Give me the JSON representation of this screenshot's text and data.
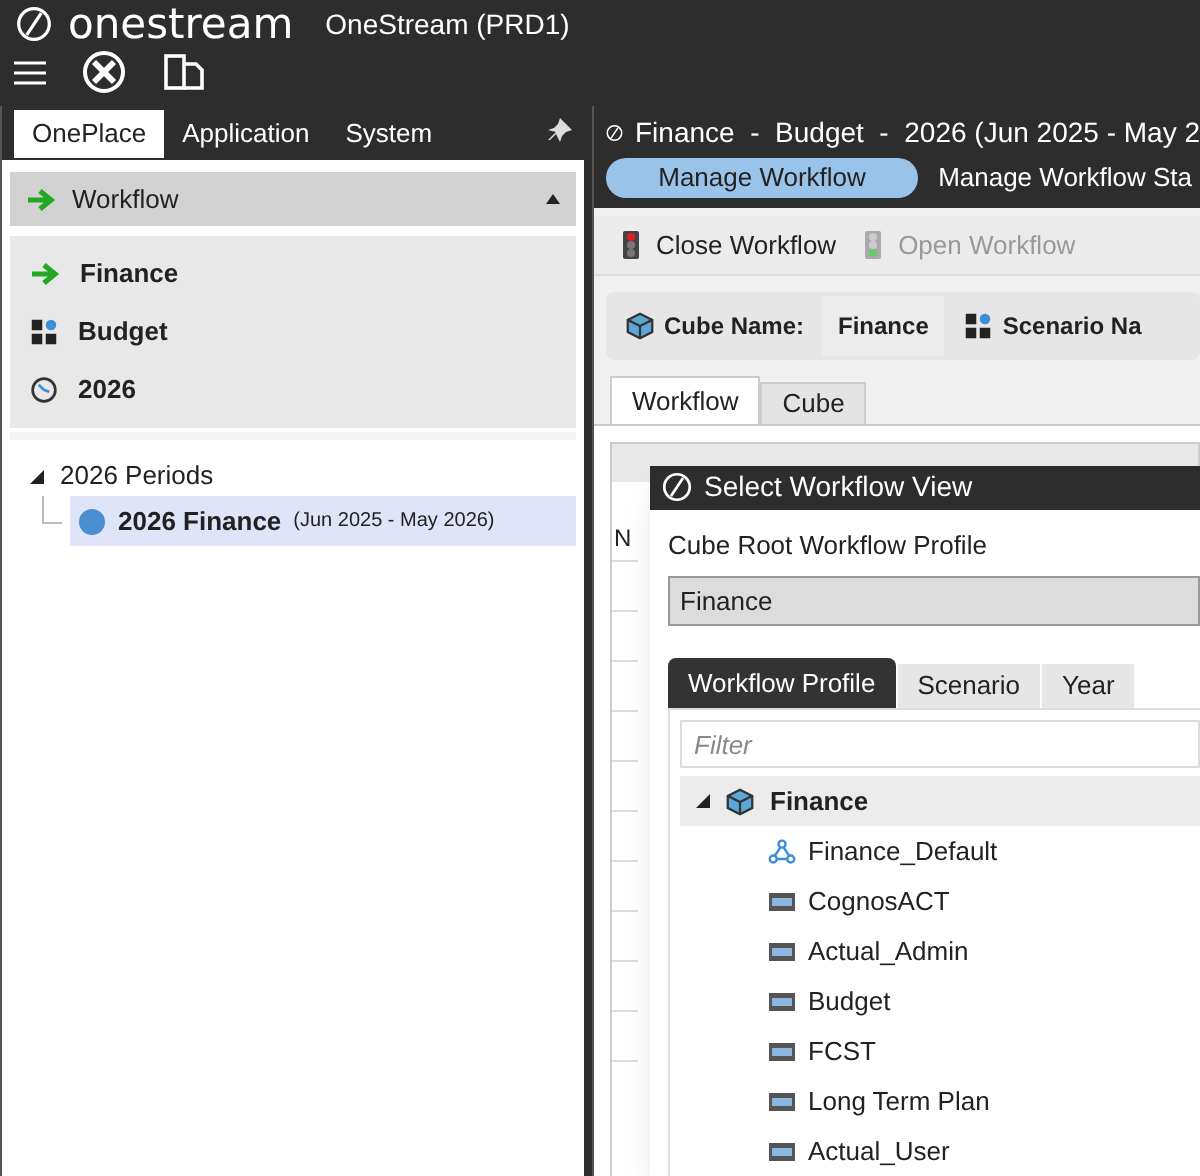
{
  "app": {
    "logo": "onestream",
    "title": "OneStream (PRD1)"
  },
  "left_panel": {
    "tabs": [
      {
        "label": "OnePlace",
        "selected": true
      },
      {
        "label": "Application",
        "selected": false
      },
      {
        "label": "System",
        "selected": false
      }
    ],
    "section": {
      "title": "Workflow",
      "expanded": true
    },
    "pov": [
      {
        "kind": "workflow",
        "label": "Finance"
      },
      {
        "kind": "scenario",
        "label": "Budget"
      },
      {
        "kind": "time",
        "label": "2026"
      }
    ],
    "tree": [
      {
        "label": "2026 Periods",
        "expanded": true,
        "children": [
          {
            "label": "2026 Finance",
            "detail": "(Jun 2025 - May 2026)",
            "selected": true
          }
        ]
      }
    ]
  },
  "right_panel": {
    "title": "Finance  -  Budget  -  2026 (Jun 2025 - May 2",
    "tabs": [
      {
        "label": "Manage Workflow",
        "selected": true
      },
      {
        "label": "Manage Workflow Sta",
        "selected": false
      }
    ],
    "toolbar": [
      {
        "label": "Close Workflow",
        "disabled": false
      },
      {
        "label": "Open Workflow",
        "disabled": true
      }
    ],
    "info": [
      {
        "kind": "cube",
        "label": "Cube Name:",
        "value": "Finance"
      },
      {
        "kind": "scenario",
        "label": "Scenario Na"
      }
    ],
    "tabs2": [
      {
        "label": "Workflow",
        "selected": true
      },
      {
        "label": "Cube",
        "selected": false
      }
    ],
    "grid": {
      "column_1": "N"
    }
  },
  "dialog": {
    "title": "Select Workflow View",
    "field_label": "Cube Root Workflow Profile",
    "field_value": "Finance",
    "tabs": [
      {
        "label": "Workflow Profile",
        "selected": true
      },
      {
        "label": "Scenario",
        "selected": false
      },
      {
        "label": "Year",
        "selected": false
      }
    ],
    "filter": {
      "placeholder": "Filter"
    },
    "tree": [
      {
        "label": "Finance",
        "kind": "cube",
        "expanded": true,
        "children": [
          {
            "label": "Finance_Default",
            "kind": "default"
          },
          {
            "label": "CognosACT",
            "kind": "profile"
          },
          {
            "label": "Actual_Admin",
            "kind": "profile"
          },
          {
            "label": "Budget",
            "kind": "profile"
          },
          {
            "label": "FCST",
            "kind": "profile"
          },
          {
            "label": "Long Term Plan",
            "kind": "profile"
          },
          {
            "label": "Actual_User",
            "kind": "profile"
          }
        ]
      }
    ]
  }
}
